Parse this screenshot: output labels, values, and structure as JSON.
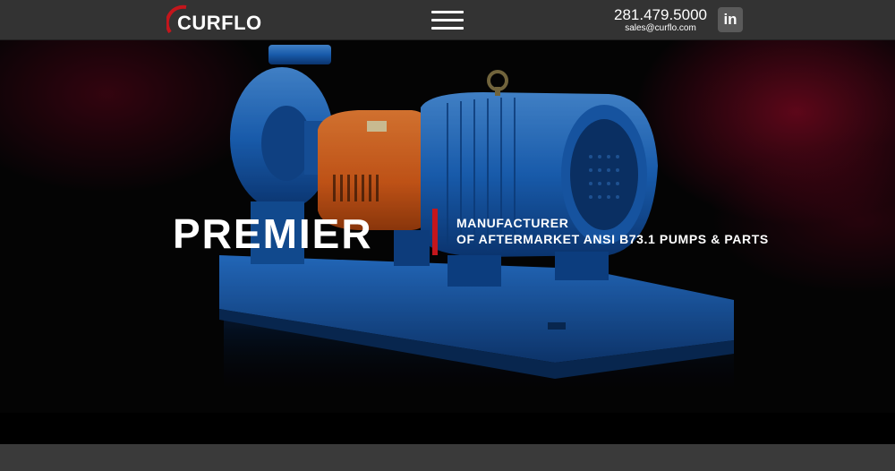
{
  "header": {
    "logo_text": "CURFLO",
    "menu_icon": "hamburger-menu-icon",
    "phone": "281.479.5000",
    "email": "sales@curflo.com",
    "linkedin_label": "in",
    "linkedin_icon": "linkedin-icon"
  },
  "hero": {
    "headline": "PREMIER",
    "tagline_line1": "MANUFACTURER",
    "tagline_line2": "OF AFTERMARKET ANSI B73.1 PUMPS & PARTS",
    "image": "centrifugal-pump-image"
  },
  "colors": {
    "header_bg": "#333333",
    "accent_red": "#c4161c",
    "pump_blue": "#1e6fd0",
    "pump_orange": "#e8641c",
    "hero_bg": "#050506"
  }
}
